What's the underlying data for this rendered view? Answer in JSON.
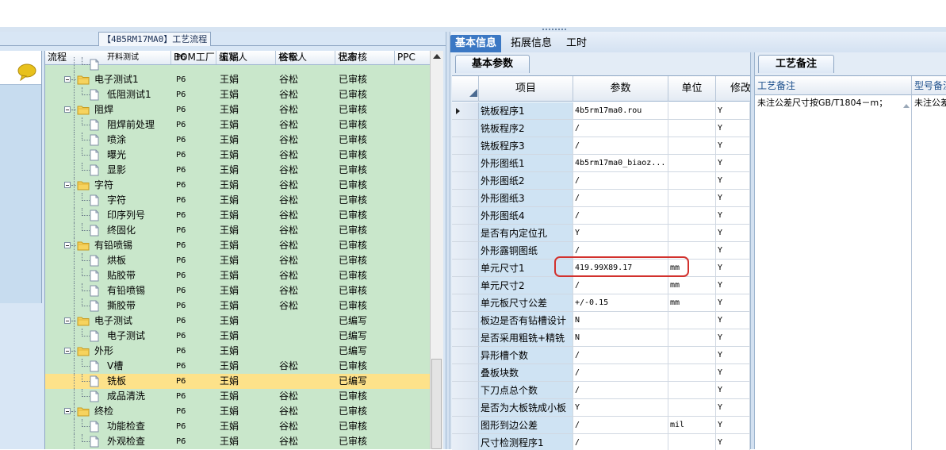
{
  "left_panel": {
    "title": "【4B5RM17MA0】工艺流程",
    "columns": [
      "流程",
      "BOM工厂",
      "编写人",
      "核审人",
      "状态",
      "PPC"
    ],
    "rows": [
      {
        "name": "开料测试",
        "level": 1,
        "kind": "doc",
        "bom": "P6",
        "writer": "王娟",
        "reviewer": "谷松",
        "status": "已审核",
        "partial": true
      },
      {
        "name": "电子测试1",
        "level": 0,
        "kind": "folder",
        "bom": "P6",
        "writer": "王娟",
        "reviewer": "谷松",
        "status": "已审核"
      },
      {
        "name": "低阻测试1",
        "level": 1,
        "kind": "doc",
        "bom": "P6",
        "writer": "王娟",
        "reviewer": "谷松",
        "status": "已审核"
      },
      {
        "name": "阻焊",
        "level": 0,
        "kind": "folder",
        "bom": "P6",
        "writer": "王娟",
        "reviewer": "谷松",
        "status": "已审核"
      },
      {
        "name": "阻焊前处理",
        "level": 1,
        "kind": "doc",
        "bom": "P6",
        "writer": "王娟",
        "reviewer": "谷松",
        "status": "已审核"
      },
      {
        "name": "喷涂",
        "level": 1,
        "kind": "doc",
        "bom": "P6",
        "writer": "王娟",
        "reviewer": "谷松",
        "status": "已审核"
      },
      {
        "name": "曝光",
        "level": 1,
        "kind": "doc",
        "bom": "P6",
        "writer": "王娟",
        "reviewer": "谷松",
        "status": "已审核"
      },
      {
        "name": "显影",
        "level": 1,
        "kind": "doc",
        "bom": "P6",
        "writer": "王娟",
        "reviewer": "谷松",
        "status": "已审核"
      },
      {
        "name": "字符",
        "level": 0,
        "kind": "folder",
        "bom": "P6",
        "writer": "王娟",
        "reviewer": "谷松",
        "status": "已审核"
      },
      {
        "name": "字符",
        "level": 1,
        "kind": "doc",
        "bom": "P6",
        "writer": "王娟",
        "reviewer": "谷松",
        "status": "已审核"
      },
      {
        "name": "印序列号",
        "level": 1,
        "kind": "doc",
        "bom": "P6",
        "writer": "王娟",
        "reviewer": "谷松",
        "status": "已审核"
      },
      {
        "name": "终固化",
        "level": 1,
        "kind": "doc",
        "bom": "P6",
        "writer": "王娟",
        "reviewer": "谷松",
        "status": "已审核"
      },
      {
        "name": "有铅喷锡",
        "level": 0,
        "kind": "folder",
        "bom": "P6",
        "writer": "王娟",
        "reviewer": "谷松",
        "status": "已审核"
      },
      {
        "name": "烘板",
        "level": 1,
        "kind": "doc",
        "bom": "P6",
        "writer": "王娟",
        "reviewer": "谷松",
        "status": "已审核"
      },
      {
        "name": "贴胶带",
        "level": 1,
        "kind": "doc",
        "bom": "P6",
        "writer": "王娟",
        "reviewer": "谷松",
        "status": "已审核"
      },
      {
        "name": "有铅喷锡",
        "level": 1,
        "kind": "doc",
        "bom": "P6",
        "writer": "王娟",
        "reviewer": "谷松",
        "status": "已审核"
      },
      {
        "name": "撕胶带",
        "level": 1,
        "kind": "doc",
        "bom": "P6",
        "writer": "王娟",
        "reviewer": "谷松",
        "status": "已审核"
      },
      {
        "name": "电子测试",
        "level": 0,
        "kind": "folder",
        "bom": "P6",
        "writer": "王娟",
        "reviewer": "",
        "status": "已编写"
      },
      {
        "name": "电子测试",
        "level": 1,
        "kind": "doc",
        "bom": "P6",
        "writer": "王娟",
        "reviewer": "",
        "status": "已编写"
      },
      {
        "name": "外形",
        "level": 0,
        "kind": "folder",
        "bom": "P6",
        "writer": "王娟",
        "reviewer": "",
        "status": "已编写"
      },
      {
        "name": "V槽",
        "level": 1,
        "kind": "doc",
        "bom": "P6",
        "writer": "王娟",
        "reviewer": "谷松",
        "status": "已审核"
      },
      {
        "name": "铣板",
        "level": 1,
        "kind": "doc",
        "bom": "P6",
        "writer": "王娟",
        "reviewer": "",
        "status": "已编写",
        "selected": true
      },
      {
        "name": "成品清洗",
        "level": 1,
        "kind": "doc",
        "bom": "P6",
        "writer": "王娟",
        "reviewer": "谷松",
        "status": "已审核"
      },
      {
        "name": "终检",
        "level": 0,
        "kind": "folder",
        "bom": "P6",
        "writer": "王娟",
        "reviewer": "谷松",
        "status": "已审核"
      },
      {
        "name": "功能检查",
        "level": 1,
        "kind": "doc",
        "bom": "P6",
        "writer": "王娟",
        "reviewer": "谷松",
        "status": "已审核"
      },
      {
        "name": "外观检查",
        "level": 1,
        "kind": "doc",
        "bom": "P6",
        "writer": "王娟",
        "reviewer": "谷松",
        "status": "已审核"
      }
    ]
  },
  "mid_tabs": [
    "基本信息",
    "拓展信息",
    "工时"
  ],
  "basic_panel": {
    "tab": "基本参数",
    "columns": [
      "项目",
      "参数",
      "单位",
      "修改"
    ],
    "rows": [
      {
        "item": "铣板程序1",
        "param": "4b5rm17ma0.rou",
        "unit": "",
        "mod": "Y",
        "current": true
      },
      {
        "item": "铣板程序2",
        "param": "/",
        "unit": "",
        "mod": "Y"
      },
      {
        "item": "铣板程序3",
        "param": "/",
        "unit": "",
        "mod": "Y"
      },
      {
        "item": "外形图纸1",
        "param": "4b5rm17ma0_biaoz...",
        "unit": "",
        "mod": "Y"
      },
      {
        "item": "外形图纸2",
        "param": "/",
        "unit": "",
        "mod": "Y"
      },
      {
        "item": "外形图纸3",
        "param": "/",
        "unit": "",
        "mod": "Y"
      },
      {
        "item": "外形图纸4",
        "param": "/",
        "unit": "",
        "mod": "Y"
      },
      {
        "item": "是否有内定位孔",
        "param": "Y",
        "unit": "",
        "mod": "Y"
      },
      {
        "item": "外形露铜图纸",
        "param": "/",
        "unit": "",
        "mod": "Y"
      },
      {
        "item": "单元尺寸1",
        "param": "419.99X89.17",
        "unit": "mm",
        "mod": "Y"
      },
      {
        "item": "单元尺寸2",
        "param": "/",
        "unit": "mm",
        "mod": "Y"
      },
      {
        "item": "单元板尺寸公差",
        "param": "+/-0.15",
        "unit": "mm",
        "mod": "Y"
      },
      {
        "item": "板边是否有钻槽设计",
        "param": "N",
        "unit": "",
        "mod": "Y"
      },
      {
        "item": "是否采用粗铣+精铣",
        "param": "N",
        "unit": "",
        "mod": "Y"
      },
      {
        "item": "异形槽个数",
        "param": "/",
        "unit": "",
        "mod": "Y"
      },
      {
        "item": "叠板块数",
        "param": "/",
        "unit": "",
        "mod": "Y"
      },
      {
        "item": "下刀点总个数",
        "param": "/",
        "unit": "",
        "mod": "Y"
      },
      {
        "item": "是否为大板铣成小板",
        "param": "Y",
        "unit": "",
        "mod": "Y"
      },
      {
        "item": "图形到边公差",
        "param": "/",
        "unit": "mil",
        "mod": "Y"
      },
      {
        "item": "尺寸检测程序1",
        "param": "/",
        "unit": "",
        "mod": "Y"
      }
    ]
  },
  "note_panel": {
    "tab": "工艺备注",
    "columns": [
      "工艺备注",
      "型号备注"
    ],
    "note_text": "未注公差尺寸按GB/T1804－m；",
    "model_note_text": "未注公差"
  }
}
